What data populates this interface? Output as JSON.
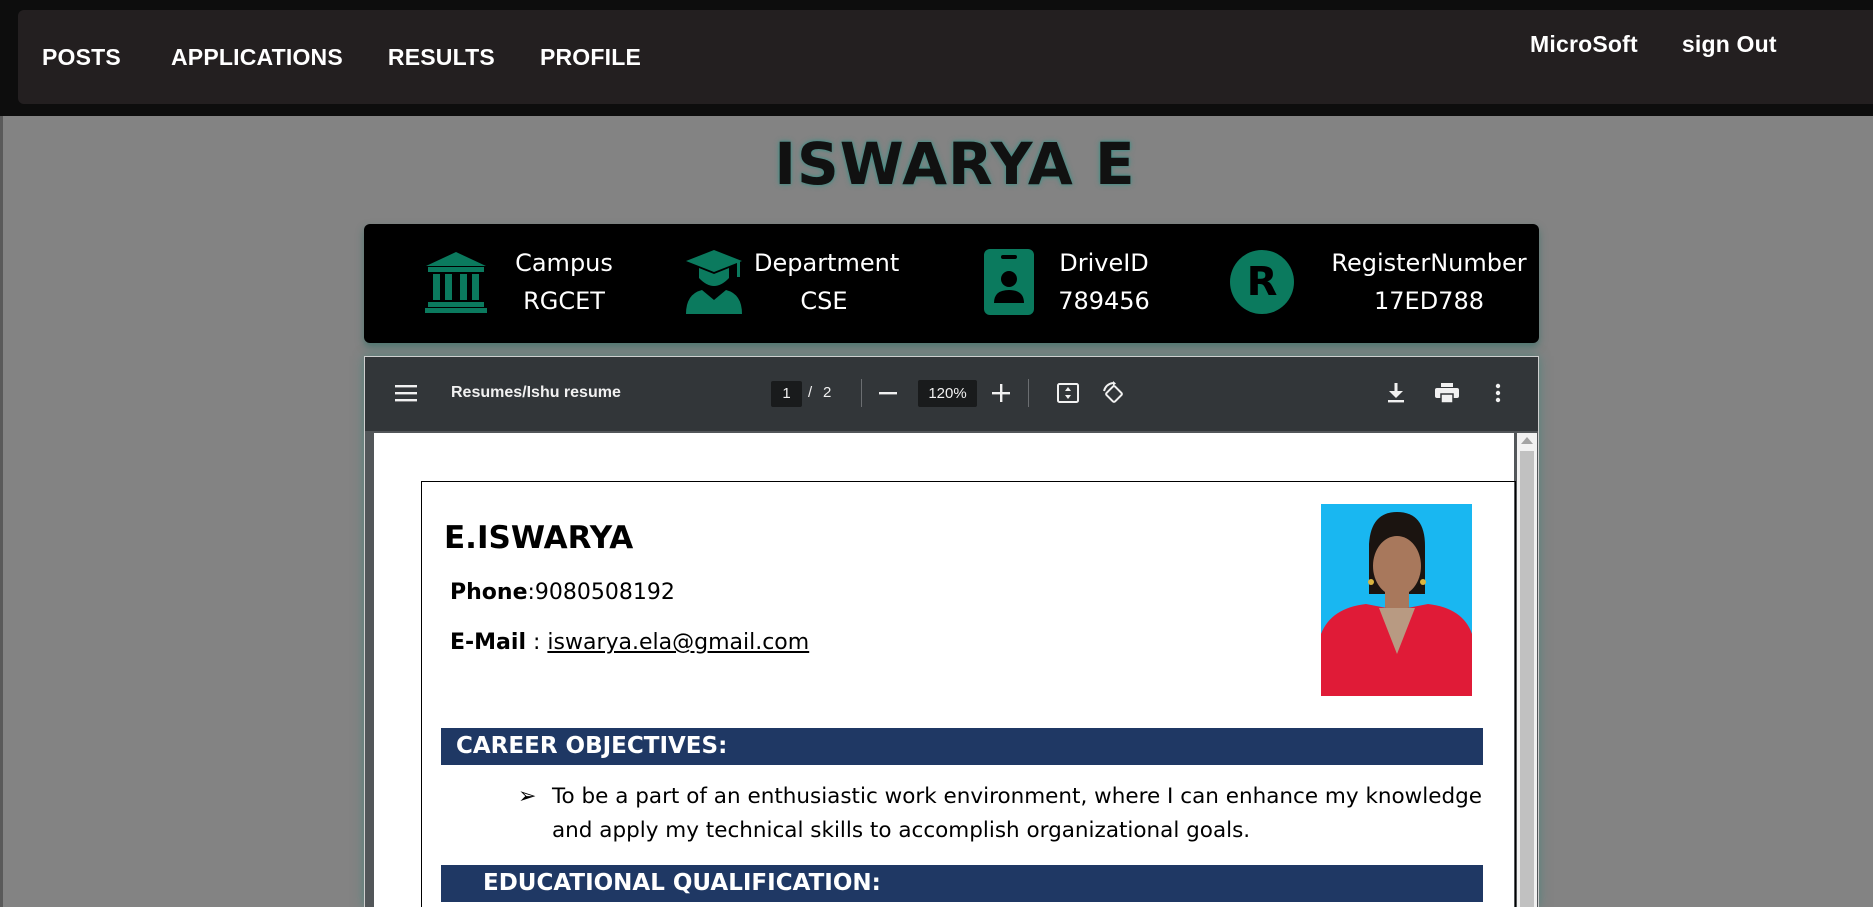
{
  "nav": {
    "left": [
      "POSTS",
      "APPLICATIONS",
      "RESULTS",
      "PROFILE"
    ],
    "company": "MicroSoft",
    "signout": "sign Out"
  },
  "student": {
    "name": "ISWARYA E"
  },
  "info": {
    "campus_label": "Campus",
    "campus_value": "RGCET",
    "department_label": "Department",
    "department_value": "CSE",
    "driveid_label": "DriveID",
    "driveid_value": "789456",
    "register_label": "RegisterNumber",
    "register_value": "17ED788",
    "register_badge": "R"
  },
  "pdf": {
    "title": "Resumes/Ishu resume",
    "current_page": "1",
    "page_separator": "/",
    "total_pages": "2",
    "zoom": "120%"
  },
  "resume": {
    "name": "E.ISWARYA",
    "phone_label": "Phone",
    "phone_value": ":9080508192",
    "email_label": "E-Mail",
    "email_sep": " : ",
    "email_value": "iswarya.ela@gmail.com",
    "section_career": "CAREER OBJECTIVES:",
    "career_bullet_symbol": "➢",
    "career_text": "To be a part of an enthusiastic work environment, where I can enhance my knowledge and apply my technical skills to accomplish organizational goals.",
    "section_education": "EDUCATIONAL QUALIFICATION:"
  },
  "colors": {
    "accent_icon": "#0b7a5e",
    "section_bar": "#1f3864",
    "nav_bg": "#231f20",
    "photo_bg": "#19b7f1"
  },
  "icons": {
    "campus": "institution-icon",
    "department": "graduation-cap-icon",
    "driveid": "id-badge-icon",
    "register": "letter-r-badge-icon",
    "sidebar_toggle": "menu-icon",
    "zoom_out": "minus-icon",
    "zoom_in": "plus-icon",
    "fit_page": "fit-to-page-icon",
    "rotate": "rotate-icon",
    "download": "download-icon",
    "print": "print-icon",
    "more": "more-vertical-icon"
  }
}
